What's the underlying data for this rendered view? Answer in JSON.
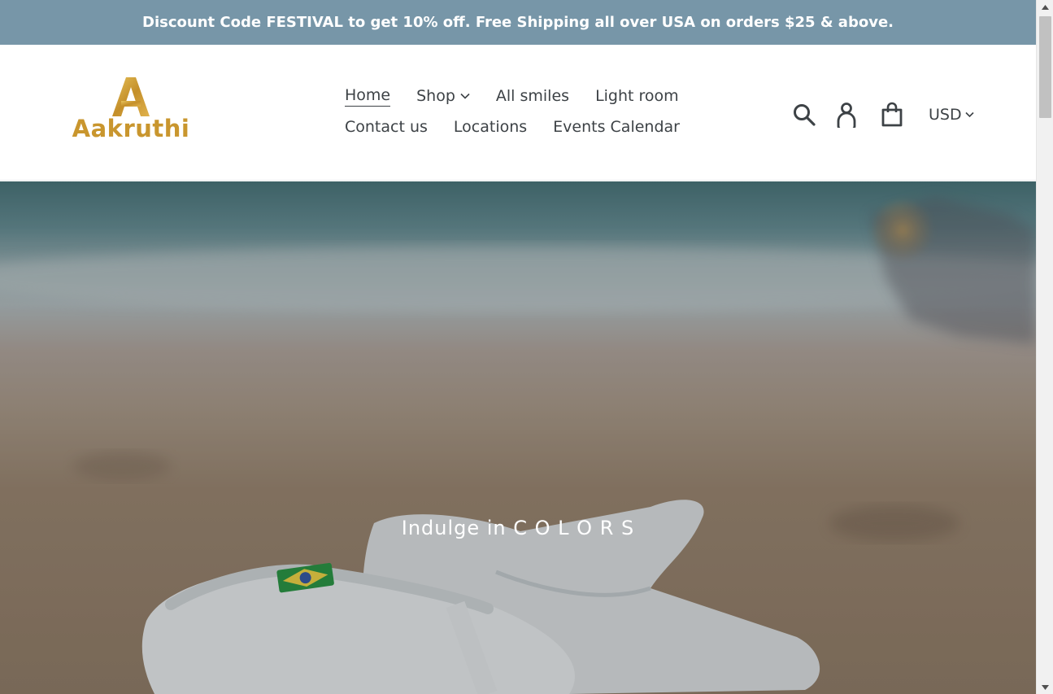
{
  "announcement": {
    "text": "Discount Code FESTIVAL to get 10% off. Free Shipping all over USA on orders $25 & above."
  },
  "brand": {
    "name": "Aakruthi",
    "logo_color": "#c9962e"
  },
  "nav": {
    "row1": [
      {
        "label": "Home",
        "active": true
      },
      {
        "label": "Shop",
        "dropdown": true
      },
      {
        "label": "All smiles"
      },
      {
        "label": "Light room"
      }
    ],
    "row2": [
      {
        "label": "Contact us"
      },
      {
        "label": "Locations"
      },
      {
        "label": "Events Calendar"
      }
    ]
  },
  "header_icons": [
    "search-icon",
    "account-icon",
    "cart-icon"
  ],
  "currency": {
    "selected": "USD"
  },
  "hero": {
    "title": "Indulge in C O L O R S"
  },
  "colors": {
    "announcement_bg": "#7796a8",
    "text": "#3d4246"
  }
}
